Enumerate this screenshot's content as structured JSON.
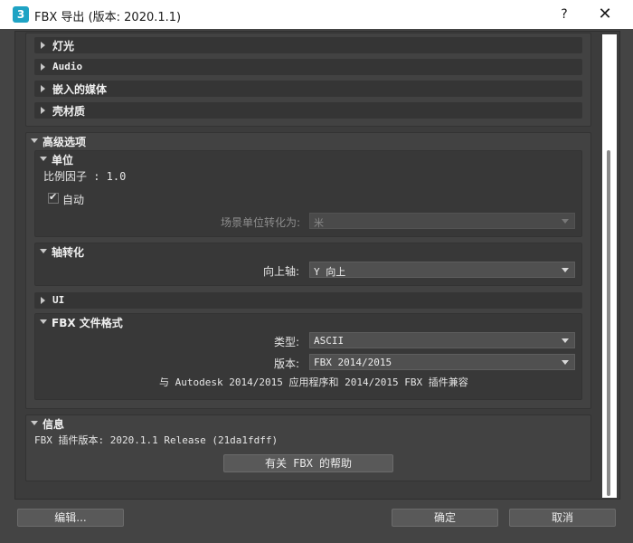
{
  "window": {
    "app_icon_label": "3",
    "title": "FBX 导出 (版本: 2020.1.1)",
    "help_label": "?",
    "close_label": "✕"
  },
  "collapsed_rollouts": [
    {
      "label": "灯光"
    },
    {
      "label": "Audio"
    },
    {
      "label": "嵌入的媒体"
    },
    {
      "label": "壳材质"
    }
  ],
  "advanced": {
    "label": "高级选项",
    "units": {
      "label": "单位",
      "scale_factor": "比例因子 : 1.0",
      "auto_label": "自动",
      "auto_checked": true,
      "scene_units_label": "场景单位转化为:",
      "scene_units_value": "米"
    },
    "axis": {
      "label": "轴转化",
      "up_axis_label": "向上轴:",
      "up_axis_value": "Y 向上"
    },
    "ui": {
      "label": "UI"
    },
    "fbx_format": {
      "label": "FBX 文件格式",
      "type_label": "类型:",
      "type_value": "ASCII",
      "version_label": "版本:",
      "version_value": "FBX 2014/2015",
      "compat_note": "与 Autodesk 2014/2015 应用程序和 2014/2015 FBX 插件兼容"
    }
  },
  "info": {
    "label": "信息",
    "plugin_version": "FBX 插件版本: 2020.1.1 Release (21da1fdff)",
    "help_button": "有关 FBX 的帮助"
  },
  "footer": {
    "edit_button": "编辑...",
    "ok_button": "确定",
    "cancel_button": "取消"
  }
}
